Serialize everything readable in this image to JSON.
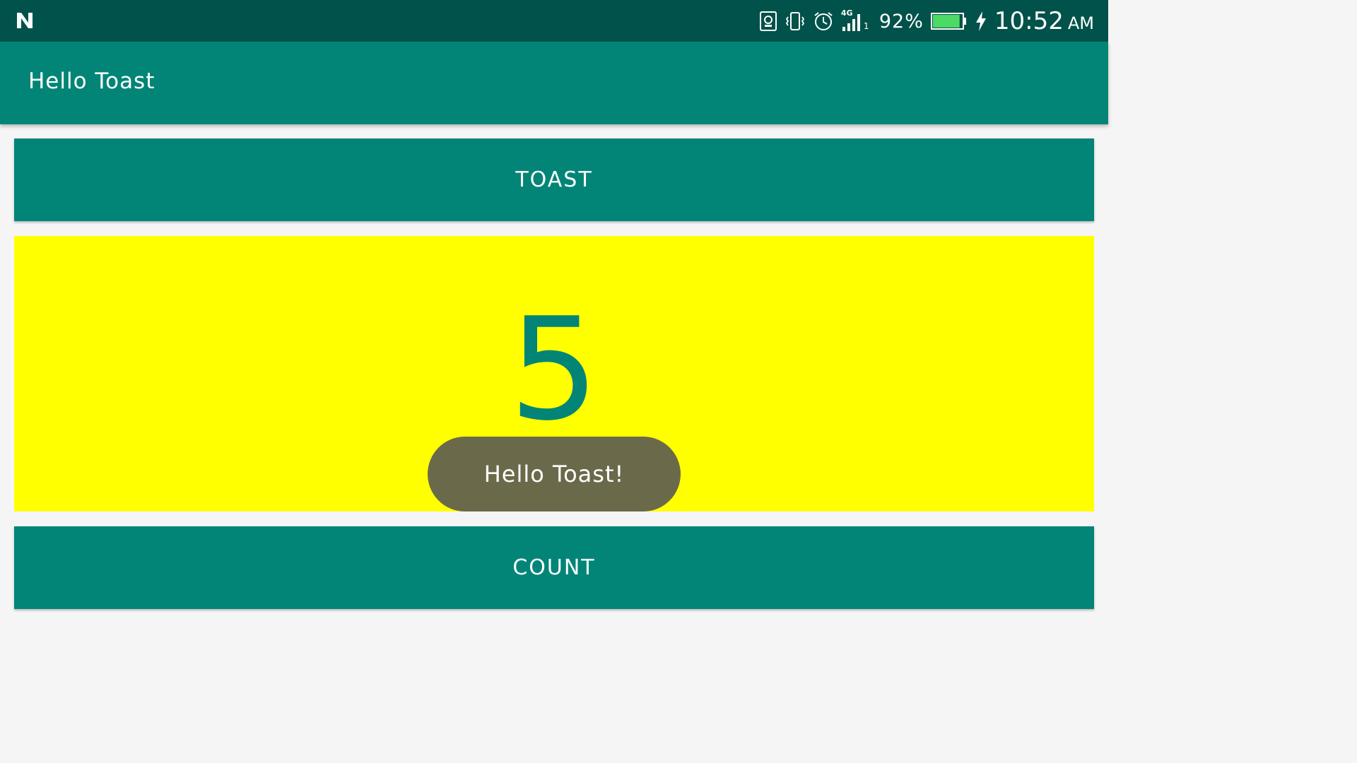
{
  "status_bar": {
    "battery_percent": "92%",
    "time": "10:52",
    "ampm": "AM",
    "network": "4G",
    "sim": "1",
    "icons": [
      "notification-n-icon",
      "screenshot-icon",
      "vibrate-icon",
      "alarm-icon",
      "signal-icon",
      "battery-icon",
      "charging-icon"
    ],
    "battery_level": 0.92,
    "battery_color": "#4cd964"
  },
  "app_bar": {
    "title": "Hello Toast",
    "color": "#028577"
  },
  "main": {
    "toast_button_label": "TOAST",
    "count_value": "5",
    "count_button_label": "COUNT",
    "count_panel_color": "#ffff00",
    "accent_color": "#028577"
  },
  "toast": {
    "message": "Hello Toast!"
  }
}
